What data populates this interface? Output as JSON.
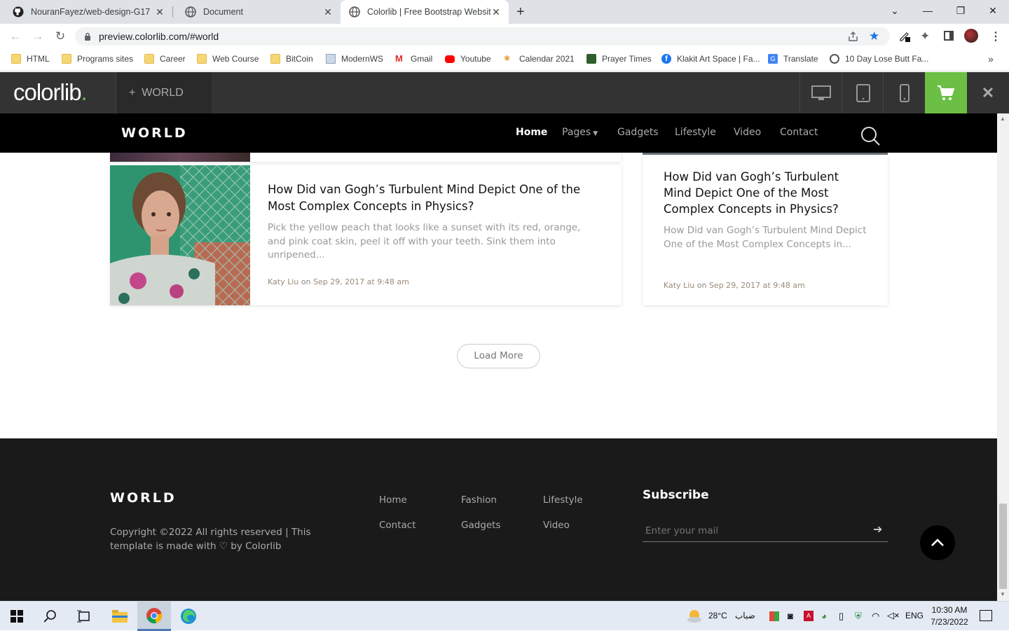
{
  "browser": {
    "tabs": [
      {
        "label": "NouranFayez/web-design-G17",
        "icon": "github-icon"
      },
      {
        "label": "Document",
        "icon": "globe-icon"
      },
      {
        "label": "Colorlib | Free Bootstrap Website",
        "icon": "globe-icon"
      }
    ],
    "url": "preview.colorlib.com/#world",
    "bookmarks": [
      "HTML",
      "Programs sites",
      "Career",
      "Web Course",
      "BitCoin",
      "ModernWS",
      "Gmail",
      "Youtube",
      "Calendar 2021",
      "Prayer Times",
      "Klakit Art Space | Fa...",
      "Translate",
      "10 Day Lose Butt Fa..."
    ],
    "bookmarks_more": "»"
  },
  "colorlib_bar": {
    "logo": "colorlib",
    "logo_dot": ".",
    "theme_name": "WORLD",
    "theme_prefix": "+"
  },
  "site": {
    "logo": "WORLD",
    "nav": [
      "Home",
      "Pages",
      "Gadgets",
      "Lifestyle",
      "Video",
      "Contact"
    ]
  },
  "cards": [
    {
      "title": "How Did van Gogh’s Turbulent Mind Depict One of the Most Complex Concepts in Physics?",
      "excerpt": "Pick the yellow peach that looks like a sunset with its red, orange, and pink coat skin, peel it off with your teeth. Sink them into unripened...",
      "author": "Katy Liu",
      "on": "on",
      "date": "Sep 29, 2017 at 9:48 am"
    },
    {
      "title": "How Did van Gogh’s Turbulent Mind Depict One of the Most Complex Concepts in Physics?",
      "excerpt": "How Did van Gogh’s Turbulent Mind Depict One of the Most Complex Concepts in...",
      "author": "Katy Liu",
      "on": "on",
      "date": "Sep 29, 2017 at 9:48 am"
    }
  ],
  "load_more": "Load More",
  "footer": {
    "logo": "WORLD",
    "copyright_1": "Copyright ©2022 All rights reserved | This",
    "copyright_2": "template is made with",
    "copyright_3": "by Colorlib",
    "links": [
      "Home",
      "Fashion",
      "Lifestyle",
      "Contact",
      "Gadgets",
      "Video"
    ],
    "subscribe_heading": "Subscribe",
    "subscribe_placeholder": "Enter your mail"
  },
  "taskbar": {
    "weather": "28°C",
    "weather_desc": "ضباب",
    "lang": "ENG",
    "time": "10:30 AM",
    "date": "7/23/2022"
  },
  "colors": {
    "accent_green": "#6bbf44",
    "footer_bg": "#1a1a1a"
  }
}
